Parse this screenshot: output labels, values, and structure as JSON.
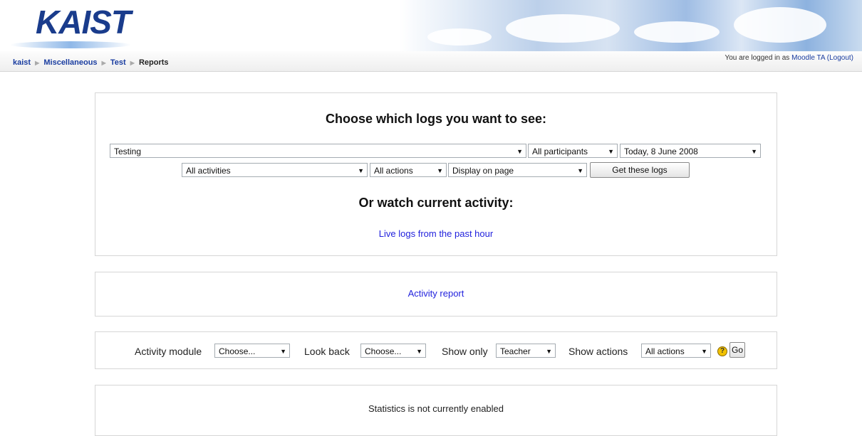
{
  "header": {
    "logo_text": "KAIST",
    "breadcrumb": {
      "home": "kaist",
      "category": "Miscellaneous",
      "course": "Test",
      "current": "Reports"
    },
    "login": {
      "prefix": "You are logged in as",
      "user": "Moodle TA",
      "logout": "(Logout)"
    }
  },
  "logs": {
    "title": "Choose which logs you want to see:",
    "course_select": "Testing",
    "participants_select": "All participants",
    "date_select": "Today, 8 June 2008",
    "activities_select": "All activities",
    "actions_select": "All actions",
    "display_select": "Display on page",
    "submit_label": "Get these logs",
    "live_title": "Or watch current activity:",
    "live_link": "Live logs from the past hour"
  },
  "activity_report": {
    "link": "Activity report"
  },
  "participation": {
    "module_label": "Activity module",
    "module_select": "Choose...",
    "lookback_label": "Look back",
    "lookback_select": "Choose...",
    "showonly_label": "Show only",
    "showonly_select": "Teacher",
    "actions_label": "Show actions",
    "actions_select": "All actions",
    "help_glyph": "?",
    "go_label": "Go"
  },
  "stats": {
    "message": "Statistics is not currently enabled"
  },
  "colors": {
    "link": "#2222dd",
    "brand": "#1a3c8c"
  }
}
